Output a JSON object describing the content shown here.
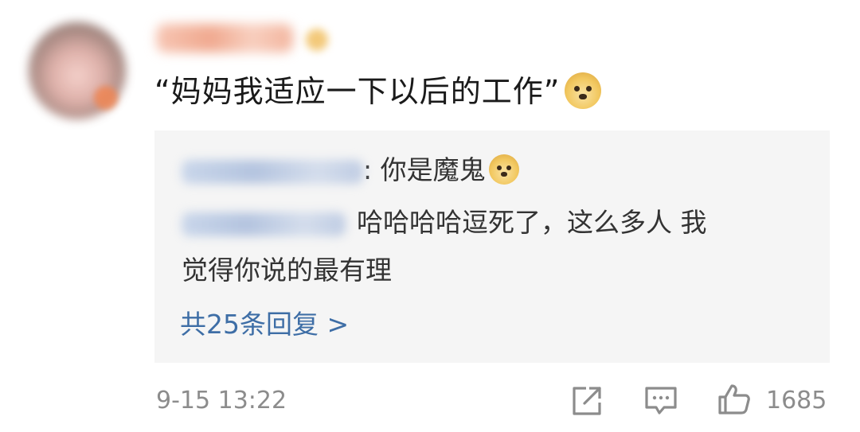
{
  "comment": {
    "text": "“妈妈我适应一下以后的工作”",
    "emoji_icon": "doge-emoji-icon"
  },
  "replies": {
    "items": [
      {
        "separator": ": ",
        "text": "你是魔鬼",
        "emoji_icon": "doge-emoji-icon"
      },
      {
        "text_line1": "哈哈哈哈逗死了，这么多人 我",
        "text_line2": "觉得你说的最有理"
      }
    ],
    "more_label": "共25条回复 >"
  },
  "meta": {
    "timestamp": "9-15 13:22",
    "like_count": "1685"
  },
  "icons": {
    "share": "share-icon",
    "comment": "comment-icon",
    "like": "thumbs-up-icon"
  },
  "colors": {
    "link_blue": "#3e6ea6",
    "reply_bg": "#f5f5f5",
    "meta_gray": "#8c8c8c",
    "text_dark": "#1a1a1a"
  }
}
